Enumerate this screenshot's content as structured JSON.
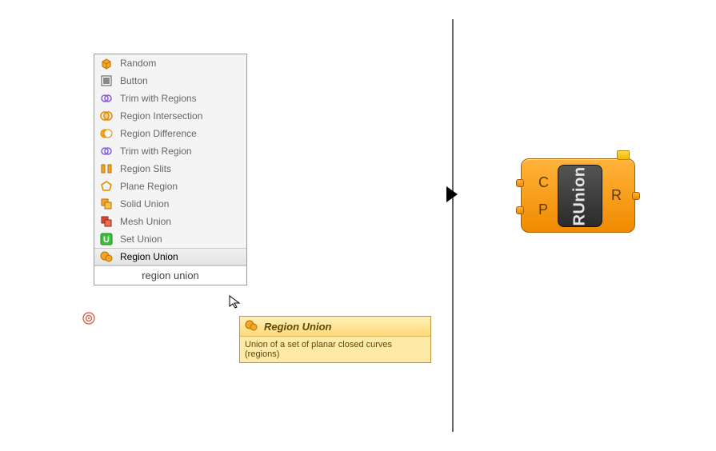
{
  "menu": {
    "items": [
      {
        "label": "Random",
        "icon": "box-orange"
      },
      {
        "label": "Button",
        "icon": "button-square"
      },
      {
        "label": "Trim with Regions",
        "icon": "two-circles-purple"
      },
      {
        "label": "Region Intersection",
        "icon": "venn-orange"
      },
      {
        "label": "Region Difference",
        "icon": "two-circles-orange"
      },
      {
        "label": "Trim with Region",
        "icon": "two-circles-purple"
      },
      {
        "label": "Region Slits",
        "icon": "brackets-orange"
      },
      {
        "label": "Plane Region",
        "icon": "pentagon-orange"
      },
      {
        "label": "Solid Union",
        "icon": "two-boxes-orange"
      },
      {
        "label": "Mesh Union",
        "icon": "two-boxes-red"
      },
      {
        "label": "Set Union",
        "icon": "u-green"
      },
      {
        "label": "Region Union",
        "icon": "blobs-orange",
        "selected": true
      }
    ],
    "search_text": "region union"
  },
  "tooltip": {
    "title": "Region Union",
    "description": "Union of a set of planar closed curves (regions)",
    "icon": "blobs-orange"
  },
  "component": {
    "name": "RUnion",
    "input_c": "C",
    "input_p": "P",
    "output_r": "R"
  }
}
